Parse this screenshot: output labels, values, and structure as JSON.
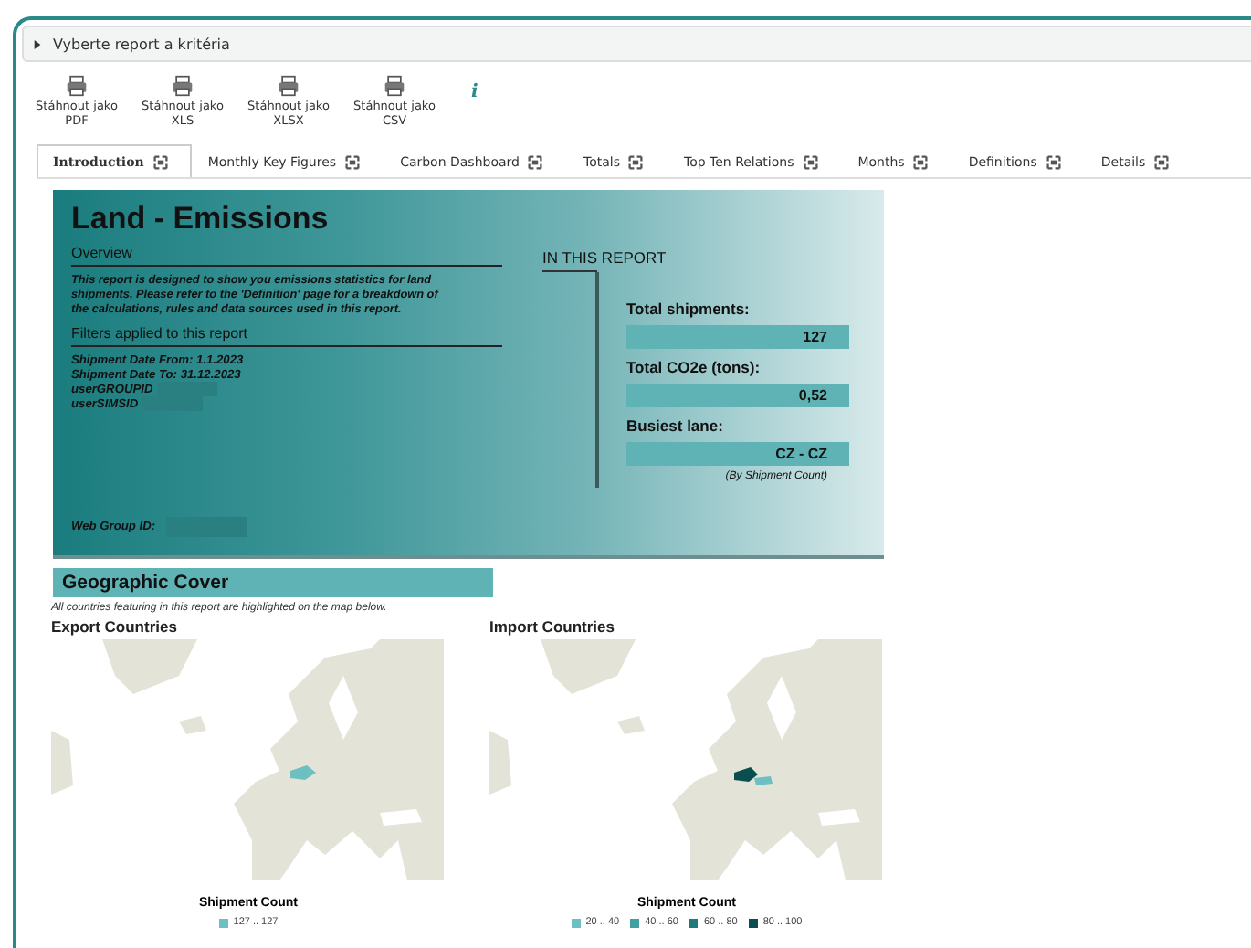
{
  "criteria_bar": {
    "label": "Vyberte report a kritéria",
    "expanded": false
  },
  "downloads": [
    {
      "label": "Stáhnout jako",
      "format": "PDF"
    },
    {
      "label": "Stáhnout jako",
      "format": "XLS"
    },
    {
      "label": "Stáhnout jako",
      "format": "XLSX"
    },
    {
      "label": "Stáhnout jako",
      "format": "CSV"
    }
  ],
  "info_icon": "i",
  "tabs": [
    {
      "label": "Introduction",
      "selected": true
    },
    {
      "label": "Monthly Key Figures",
      "selected": false
    },
    {
      "label": "Carbon Dashboard",
      "selected": false
    },
    {
      "label": "Totals",
      "selected": false
    },
    {
      "label": "Top Ten Relations",
      "selected": false
    },
    {
      "label": "Months",
      "selected": false
    },
    {
      "label": "Definitions",
      "selected": false
    },
    {
      "label": "Details",
      "selected": false
    }
  ],
  "report": {
    "title": "Land - Emissions",
    "overview_heading": "Overview",
    "overview_text": "This report is designed to show you emissions statistics for land shipments. Please refer to the 'Definition' page for a breakdown of the calculations, rules and data sources used in this report.",
    "filters_heading": "Filters applied to this report",
    "filters": [
      {
        "label": "Shipment Date From: 1.1.2023",
        "redacted": false
      },
      {
        "label": "Shipment Date To: 31.12.2023",
        "redacted": false
      },
      {
        "label": "userGROUPID",
        "redacted": true
      },
      {
        "label": "userSIMSID",
        "redacted": true
      }
    ],
    "web_group_label": "Web Group ID:",
    "in_this_report": "IN THIS REPORT",
    "stats": [
      {
        "label": "Total shipments:",
        "value": "127"
      },
      {
        "label": "Total CO2e (tons):",
        "value": "0,52"
      },
      {
        "label": "Busiest lane:",
        "value": "CZ - CZ"
      }
    ],
    "stats_note": "(By Shipment Count)"
  },
  "geographic": {
    "heading": "Geographic Cover",
    "note": "All countries featuring in this report are highlighted on the map below.",
    "maps": [
      {
        "title": "Export Countries",
        "legend_title": "Shipment Count",
        "legend": [
          {
            "label": "127 .. 127",
            "color": "#6cc0c2"
          }
        ]
      },
      {
        "title": "Import Countries",
        "legend_title": "Shipment Count",
        "legend": [
          {
            "label": "20 .. 40",
            "color": "#6cc0c2"
          },
          {
            "label": "40 .. 60",
            "color": "#3f9fa1"
          },
          {
            "label": "60 .. 80",
            "color": "#1f7a7b"
          },
          {
            "label": "80 .. 100",
            "color": "#0b4e4f"
          }
        ]
      }
    ]
  }
}
